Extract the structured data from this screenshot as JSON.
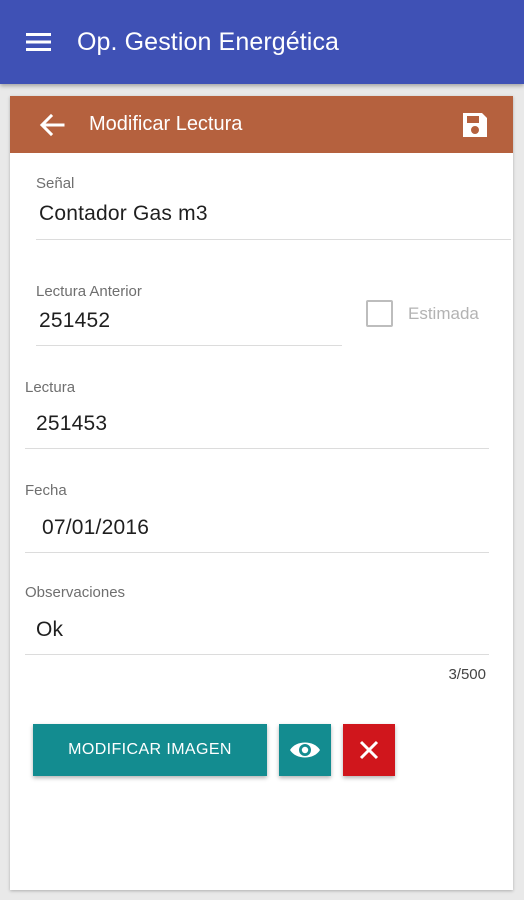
{
  "colors": {
    "primary": "#3f51b5",
    "header": "#b5613e",
    "teal": "#138c90",
    "danger": "#d0161c"
  },
  "appbar": {
    "title": "Op. Gestion Energética",
    "menu_icon": "menu-icon"
  },
  "form": {
    "title": "Modificar Lectura",
    "back_icon": "arrow-left-icon",
    "save_icon": "save-icon",
    "fields": {
      "senal": {
        "label": "Señal",
        "value": "Contador Gas m3"
      },
      "lectura_anterior": {
        "label": "Lectura Anterior",
        "value": "251452"
      },
      "estimada": {
        "label": "Estimada",
        "checked": false
      },
      "lectura": {
        "label": "Lectura",
        "value": "251453"
      },
      "fecha": {
        "label": "Fecha",
        "value": "07/01/2016"
      },
      "observaciones": {
        "label": "Observaciones",
        "value": "Ok",
        "counter": "3/500"
      }
    },
    "buttons": {
      "modify_image": "MODIFICAR IMAGEN",
      "view_icon": "eye-icon",
      "delete_icon": "close-icon"
    }
  }
}
